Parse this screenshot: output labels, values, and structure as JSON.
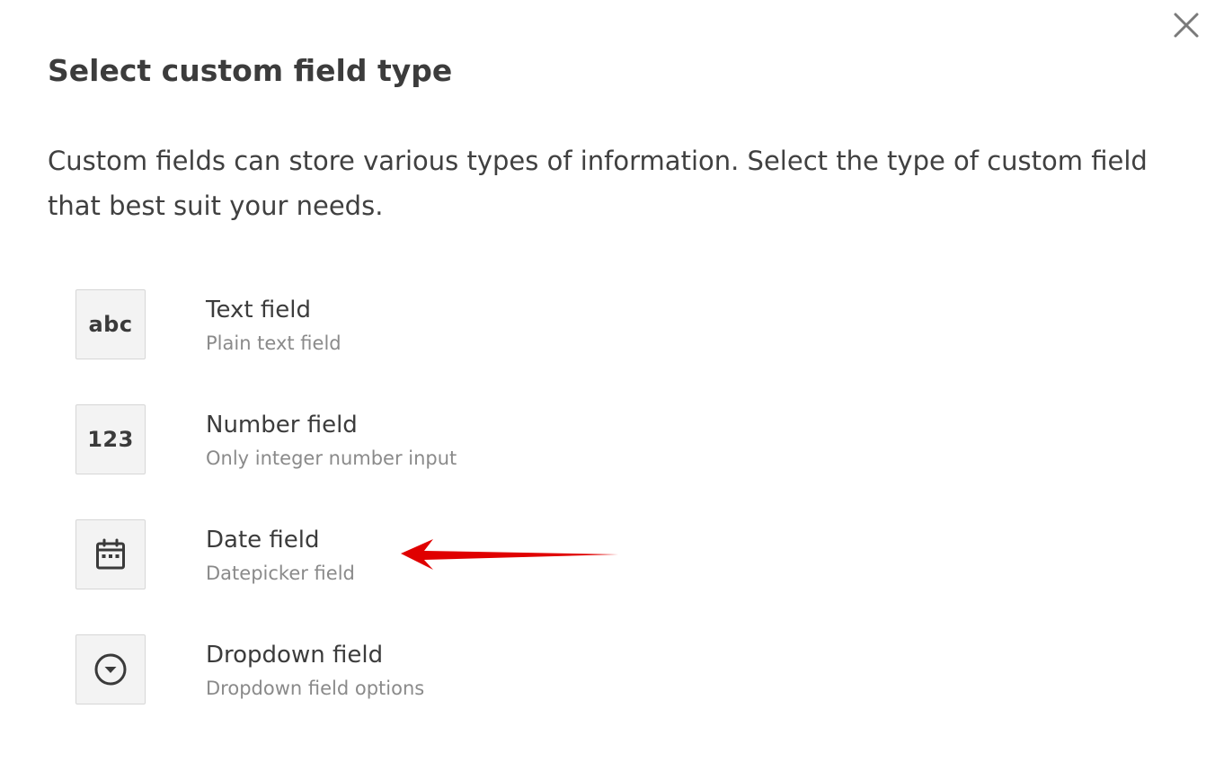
{
  "dialog": {
    "title": "Select custom field type",
    "description": "Custom fields can store various types of information. Select the type of custom field that best suit your needs.",
    "close_icon": "close-icon"
  },
  "options": [
    {
      "icon_name": "text-abc-icon",
      "icon_text": "abc",
      "label": "Text field",
      "sublabel": "Plain text field"
    },
    {
      "icon_name": "number-123-icon",
      "icon_text": "123",
      "label": "Number field",
      "sublabel": "Only integer number input"
    },
    {
      "icon_name": "calendar-icon",
      "icon_text": "",
      "label": "Date field",
      "sublabel": "Datepicker field"
    },
    {
      "icon_name": "dropdown-circle-icon",
      "icon_text": "",
      "label": "Dropdown field",
      "sublabel": "Dropdown field options"
    }
  ],
  "annotation": {
    "arrow_color": "#e00000",
    "points_to": "Date field"
  }
}
